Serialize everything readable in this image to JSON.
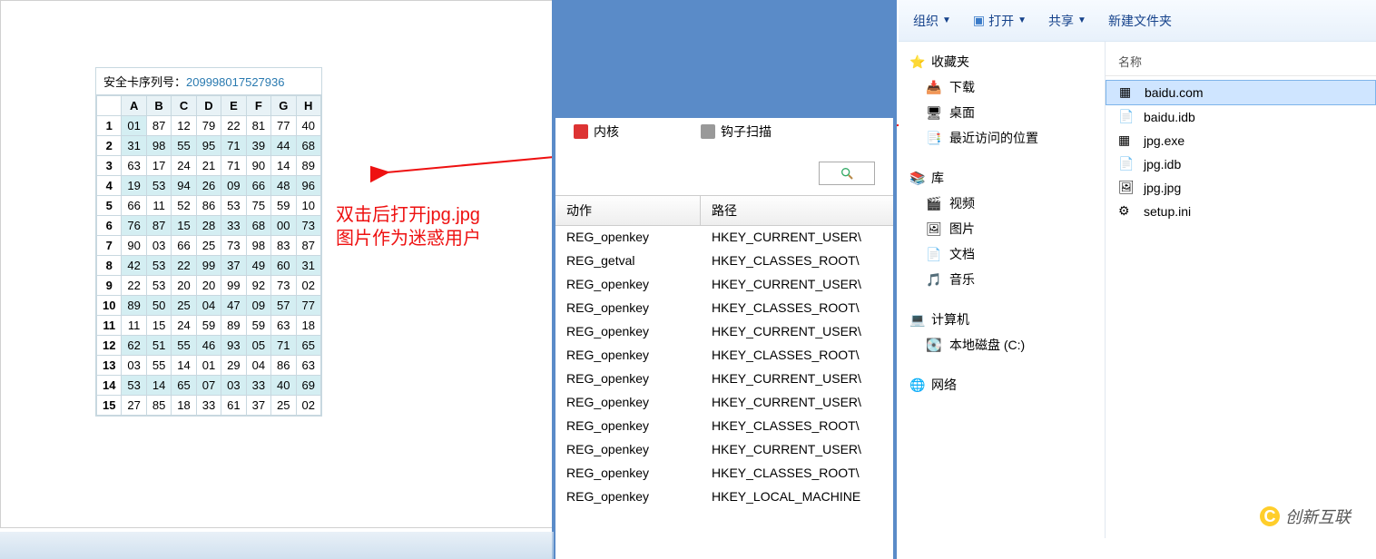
{
  "card": {
    "label": "安全卡序列号：",
    "serial": "209998017527936",
    "cols": [
      "A",
      "B",
      "C",
      "D",
      "E",
      "F",
      "G",
      "H"
    ],
    "rows": [
      {
        "n": "1",
        "v": [
          "01",
          "87",
          "12",
          "79",
          "22",
          "81",
          "77",
          "40"
        ],
        "hi": [
          0
        ]
      },
      {
        "n": "2",
        "v": [
          "31",
          "98",
          "55",
          "95",
          "71",
          "39",
          "44",
          "68"
        ],
        "hi": [
          0,
          1,
          2,
          3,
          4,
          5,
          6,
          7
        ]
      },
      {
        "n": "3",
        "v": [
          "63",
          "17",
          "24",
          "21",
          "71",
          "90",
          "14",
          "89"
        ]
      },
      {
        "n": "4",
        "v": [
          "19",
          "53",
          "94",
          "26",
          "09",
          "66",
          "48",
          "96"
        ],
        "hi": [
          0,
          1,
          2,
          3,
          4,
          5,
          6,
          7
        ]
      },
      {
        "n": "5",
        "v": [
          "66",
          "11",
          "52",
          "86",
          "53",
          "75",
          "59",
          "10"
        ]
      },
      {
        "n": "6",
        "v": [
          "76",
          "87",
          "15",
          "28",
          "33",
          "68",
          "00",
          "73"
        ],
        "hi": [
          0,
          1,
          2,
          3,
          4,
          5,
          6,
          7
        ]
      },
      {
        "n": "7",
        "v": [
          "90",
          "03",
          "66",
          "25",
          "73",
          "98",
          "83",
          "87"
        ]
      },
      {
        "n": "8",
        "v": [
          "42",
          "53",
          "22",
          "99",
          "37",
          "49",
          "60",
          "31"
        ],
        "hi": [
          0,
          1,
          2,
          3,
          4,
          5,
          6,
          7
        ]
      },
      {
        "n": "9",
        "v": [
          "22",
          "53",
          "20",
          "20",
          "99",
          "92",
          "73",
          "02"
        ]
      },
      {
        "n": "10",
        "v": [
          "89",
          "50",
          "25",
          "04",
          "47",
          "09",
          "57",
          "77"
        ],
        "hi": [
          0,
          1,
          2,
          3,
          4,
          5,
          6,
          7
        ]
      },
      {
        "n": "11",
        "v": [
          "11",
          "15",
          "24",
          "59",
          "89",
          "59",
          "63",
          "18"
        ]
      },
      {
        "n": "12",
        "v": [
          "62",
          "51",
          "55",
          "46",
          "93",
          "05",
          "71",
          "65"
        ],
        "hi": [
          0,
          1,
          2,
          3,
          4,
          5,
          6,
          7
        ]
      },
      {
        "n": "13",
        "v": [
          "03",
          "55",
          "14",
          "01",
          "29",
          "04",
          "86",
          "63"
        ]
      },
      {
        "n": "14",
        "v": [
          "53",
          "14",
          "65",
          "07",
          "03",
          "33",
          "40",
          "69"
        ],
        "hi": [
          0,
          1,
          2,
          3,
          4,
          5,
          6,
          7
        ]
      },
      {
        "n": "15",
        "v": [
          "27",
          "85",
          "18",
          "33",
          "61",
          "37",
          "25",
          "02"
        ]
      }
    ]
  },
  "annotation": {
    "line1": "双击后打开jpg.jpg",
    "line2": "图片作为迷惑用户"
  },
  "mid": {
    "tabs": [
      {
        "icon": "kernel-icon",
        "label": "内核"
      },
      {
        "icon": "hook-icon",
        "label": "钩子扫描"
      }
    ],
    "headers": {
      "c1": "动作",
      "c2": "路径"
    },
    "rows": [
      {
        "a": "REG_openkey",
        "p": "HKEY_CURRENT_USER\\"
      },
      {
        "a": "REG_getval",
        "p": "HKEY_CLASSES_ROOT\\"
      },
      {
        "a": "REG_openkey",
        "p": "HKEY_CURRENT_USER\\"
      },
      {
        "a": "REG_openkey",
        "p": "HKEY_CLASSES_ROOT\\"
      },
      {
        "a": "REG_openkey",
        "p": "HKEY_CURRENT_USER\\"
      },
      {
        "a": "REG_openkey",
        "p": "HKEY_CLASSES_ROOT\\"
      },
      {
        "a": "REG_openkey",
        "p": "HKEY_CURRENT_USER\\"
      },
      {
        "a": "REG_openkey",
        "p": "HKEY_CURRENT_USER\\"
      },
      {
        "a": "REG_openkey",
        "p": "HKEY_CLASSES_ROOT\\"
      },
      {
        "a": "REG_openkey",
        "p": "HKEY_CURRENT_USER\\"
      },
      {
        "a": "REG_openkey",
        "p": "HKEY_CLASSES_ROOT\\"
      },
      {
        "a": "REG_openkey",
        "p": "HKEY_LOCAL_MACHINE"
      }
    ]
  },
  "explorer": {
    "toolbar": {
      "organize": "组织",
      "open": "打开",
      "share": "共享",
      "newfolder": "新建文件夹"
    },
    "nav": {
      "fav": {
        "head": "收藏夹",
        "items": [
          "下载",
          "桌面",
          "最近访问的位置"
        ]
      },
      "lib": {
        "head": "库",
        "items": [
          "视频",
          "图片",
          "文档",
          "音乐"
        ]
      },
      "comp": {
        "head": "计算机",
        "items": [
          "本地磁盘 (C:)"
        ]
      },
      "net": {
        "head": "网络"
      }
    },
    "content": {
      "header": "名称",
      "files": [
        {
          "name": "baidu.com",
          "type": "exe",
          "selected": true
        },
        {
          "name": "baidu.idb",
          "type": "file"
        },
        {
          "name": "jpg.exe",
          "type": "exe"
        },
        {
          "name": "jpg.idb",
          "type": "file"
        },
        {
          "name": "jpg.jpg",
          "type": "image"
        },
        {
          "name": "setup.ini",
          "type": "ini"
        }
      ]
    }
  },
  "watermark": "创新互联"
}
